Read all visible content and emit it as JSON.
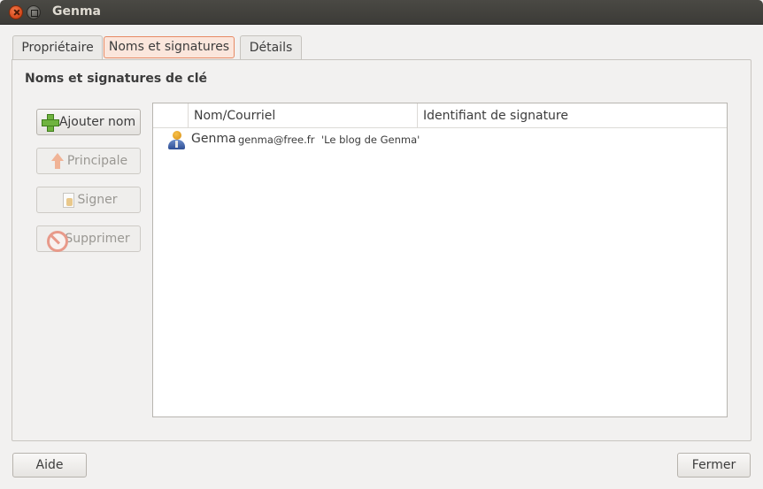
{
  "window": {
    "title": "Genma"
  },
  "tabs": [
    {
      "label": "Propriétaire"
    },
    {
      "label": "Noms et signatures"
    },
    {
      "label": "Détails"
    }
  ],
  "active_tab": "Noms et signatures",
  "section": {
    "title": "Noms et signatures de clé"
  },
  "actions": {
    "add": {
      "label": "Ajouter nom",
      "icon": "plus-icon",
      "enabled": true
    },
    "primary": {
      "label": "Principale",
      "icon": "up-arrow-icon",
      "enabled": false
    },
    "sign": {
      "label": "Signer",
      "icon": "sign-icon",
      "enabled": false
    },
    "delete": {
      "label": "Supprimer",
      "icon": "delete-icon",
      "enabled": false
    }
  },
  "table": {
    "columns": [
      "",
      "Nom/Courriel",
      "Identifiant de signature"
    ],
    "rows": [
      {
        "icon": "user-icon",
        "name": "Genma",
        "email": "genma@free.fr",
        "comment": "'Le blog de Genma'"
      }
    ]
  },
  "footer": {
    "help_label": "Aide",
    "close_label": "Fermer"
  },
  "colors": {
    "titlebar": "#3c3b37",
    "active_tab_bg": "#fbe6dc",
    "active_tab_border": "#e78a64",
    "close_button": "#d2461a"
  }
}
